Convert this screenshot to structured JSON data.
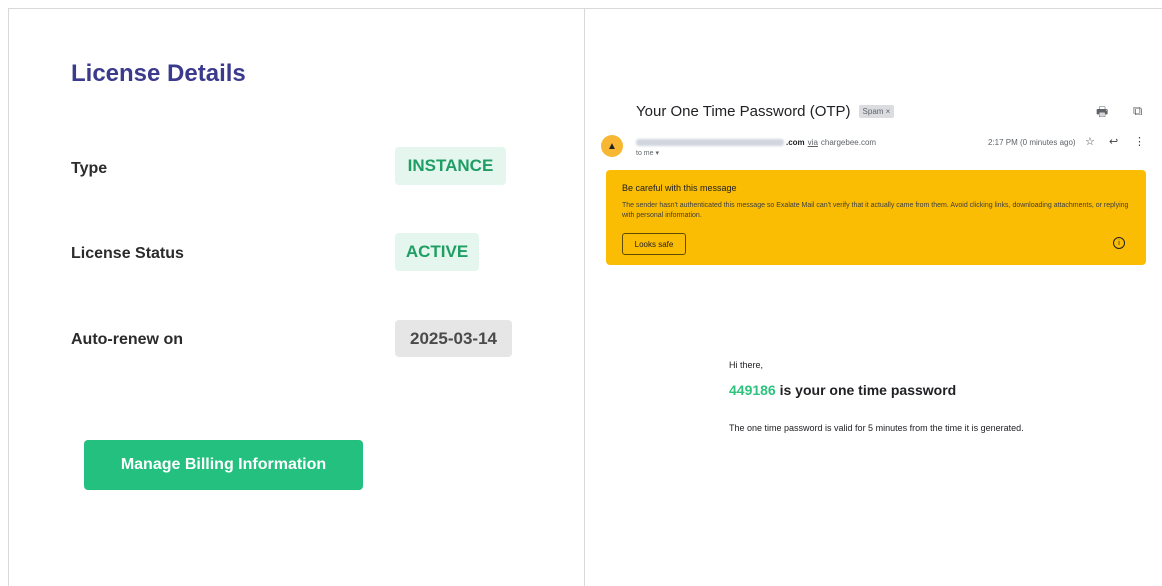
{
  "license": {
    "title": "License Details",
    "rows": [
      {
        "label": "Type",
        "value": "INSTANCE"
      },
      {
        "label": "License Status",
        "value": "ACTIVE"
      },
      {
        "label": "Auto-renew on",
        "value": "2025-03-14"
      }
    ],
    "billing_button": "Manage Billing Information"
  },
  "email": {
    "subject": "Your One Time Password (OTP)",
    "spam_label": "Spam ×",
    "sender_domain": ".com",
    "sender_via": "via",
    "sender_host": "chargebee.com",
    "to": "to me ▾",
    "time": "2:17 PM (0 minutes ago)",
    "warning": {
      "title": "Be careful with this message",
      "body": "The sender hasn't authenticated this message so Exalate Mail can't verify that it actually came from them. Avoid clicking links, downloading attachments, or replying with personal information.",
      "button": "Looks safe"
    },
    "greeting": "Hi there,",
    "otp_code": "449186",
    "otp_suffix": " is your one time password",
    "otp_note": "The one time password is valid for 5 minutes from the time it is generated."
  },
  "colors": {
    "accent_green": "#23c07f",
    "title_blue": "#3b3a8c",
    "warning_yellow": "#fbbc04"
  },
  "icons": [
    "print-icon",
    "open-new-window-icon",
    "warning-icon",
    "star-icon",
    "reply-icon",
    "more-vert-icon",
    "info-icon"
  ]
}
